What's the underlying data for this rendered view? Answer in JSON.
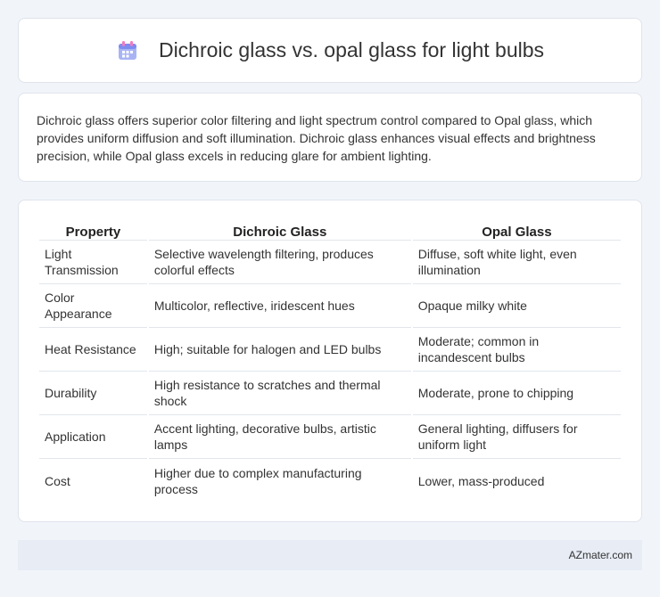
{
  "header": {
    "title": "Dichroic glass vs. opal glass for light bulbs",
    "icon": "calendar-icon",
    "icon_colors": [
      "#7c8cf0",
      "#f07cc0"
    ]
  },
  "intro": {
    "text": "Dichroic glass offers superior color filtering and light spectrum control compared to Opal glass, which provides uniform diffusion and soft illumination. Dichroic glass enhances visual effects and brightness precision, while Opal glass excels in reducing glare for ambient lighting."
  },
  "table": {
    "headers": [
      "Property",
      "Dichroic Glass",
      "Opal Glass"
    ],
    "rows": [
      [
        "Light Transmission",
        "Selective wavelength filtering, produces colorful effects",
        "Diffuse, soft white light, even illumination"
      ],
      [
        "Color Appearance",
        "Multicolor, reflective, iridescent hues",
        "Opaque milky white"
      ],
      [
        "Heat Resistance",
        "High; suitable for halogen and LED bulbs",
        "Moderate; common in incandescent bulbs"
      ],
      [
        "Durability",
        "High resistance to scratches and thermal shock",
        "Moderate, prone to chipping"
      ],
      [
        "Application",
        "Accent lighting, decorative bulbs, artistic lamps",
        "General lighting, diffusers for uniform light"
      ],
      [
        "Cost",
        "Higher due to complex manufacturing process",
        "Lower, mass-produced"
      ]
    ]
  },
  "footer": {
    "text": "AZmater.com"
  }
}
